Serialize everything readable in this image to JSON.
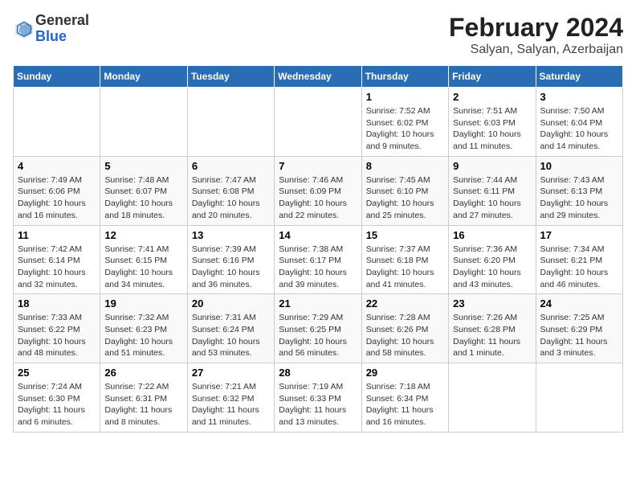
{
  "logo": {
    "general": "General",
    "blue": "Blue"
  },
  "title": "February 2024",
  "subtitle": "Salyan, Salyan, Azerbaijan",
  "days_of_week": [
    "Sunday",
    "Monday",
    "Tuesday",
    "Wednesday",
    "Thursday",
    "Friday",
    "Saturday"
  ],
  "weeks": [
    [
      {
        "day": "",
        "content": ""
      },
      {
        "day": "",
        "content": ""
      },
      {
        "day": "",
        "content": ""
      },
      {
        "day": "",
        "content": ""
      },
      {
        "day": "1",
        "content": "Sunrise: 7:52 AM\nSunset: 6:02 PM\nDaylight: 10 hours and 9 minutes."
      },
      {
        "day": "2",
        "content": "Sunrise: 7:51 AM\nSunset: 6:03 PM\nDaylight: 10 hours and 11 minutes."
      },
      {
        "day": "3",
        "content": "Sunrise: 7:50 AM\nSunset: 6:04 PM\nDaylight: 10 hours and 14 minutes."
      }
    ],
    [
      {
        "day": "4",
        "content": "Sunrise: 7:49 AM\nSunset: 6:06 PM\nDaylight: 10 hours and 16 minutes."
      },
      {
        "day": "5",
        "content": "Sunrise: 7:48 AM\nSunset: 6:07 PM\nDaylight: 10 hours and 18 minutes."
      },
      {
        "day": "6",
        "content": "Sunrise: 7:47 AM\nSunset: 6:08 PM\nDaylight: 10 hours and 20 minutes."
      },
      {
        "day": "7",
        "content": "Sunrise: 7:46 AM\nSunset: 6:09 PM\nDaylight: 10 hours and 22 minutes."
      },
      {
        "day": "8",
        "content": "Sunrise: 7:45 AM\nSunset: 6:10 PM\nDaylight: 10 hours and 25 minutes."
      },
      {
        "day": "9",
        "content": "Sunrise: 7:44 AM\nSunset: 6:11 PM\nDaylight: 10 hours and 27 minutes."
      },
      {
        "day": "10",
        "content": "Sunrise: 7:43 AM\nSunset: 6:13 PM\nDaylight: 10 hours and 29 minutes."
      }
    ],
    [
      {
        "day": "11",
        "content": "Sunrise: 7:42 AM\nSunset: 6:14 PM\nDaylight: 10 hours and 32 minutes."
      },
      {
        "day": "12",
        "content": "Sunrise: 7:41 AM\nSunset: 6:15 PM\nDaylight: 10 hours and 34 minutes."
      },
      {
        "day": "13",
        "content": "Sunrise: 7:39 AM\nSunset: 6:16 PM\nDaylight: 10 hours and 36 minutes."
      },
      {
        "day": "14",
        "content": "Sunrise: 7:38 AM\nSunset: 6:17 PM\nDaylight: 10 hours and 39 minutes."
      },
      {
        "day": "15",
        "content": "Sunrise: 7:37 AM\nSunset: 6:18 PM\nDaylight: 10 hours and 41 minutes."
      },
      {
        "day": "16",
        "content": "Sunrise: 7:36 AM\nSunset: 6:20 PM\nDaylight: 10 hours and 43 minutes."
      },
      {
        "day": "17",
        "content": "Sunrise: 7:34 AM\nSunset: 6:21 PM\nDaylight: 10 hours and 46 minutes."
      }
    ],
    [
      {
        "day": "18",
        "content": "Sunrise: 7:33 AM\nSunset: 6:22 PM\nDaylight: 10 hours and 48 minutes."
      },
      {
        "day": "19",
        "content": "Sunrise: 7:32 AM\nSunset: 6:23 PM\nDaylight: 10 hours and 51 minutes."
      },
      {
        "day": "20",
        "content": "Sunrise: 7:31 AM\nSunset: 6:24 PM\nDaylight: 10 hours and 53 minutes."
      },
      {
        "day": "21",
        "content": "Sunrise: 7:29 AM\nSunset: 6:25 PM\nDaylight: 10 hours and 56 minutes."
      },
      {
        "day": "22",
        "content": "Sunrise: 7:28 AM\nSunset: 6:26 PM\nDaylight: 10 hours and 58 minutes."
      },
      {
        "day": "23",
        "content": "Sunrise: 7:26 AM\nSunset: 6:28 PM\nDaylight: 11 hours and 1 minute."
      },
      {
        "day": "24",
        "content": "Sunrise: 7:25 AM\nSunset: 6:29 PM\nDaylight: 11 hours and 3 minutes."
      }
    ],
    [
      {
        "day": "25",
        "content": "Sunrise: 7:24 AM\nSunset: 6:30 PM\nDaylight: 11 hours and 6 minutes."
      },
      {
        "day": "26",
        "content": "Sunrise: 7:22 AM\nSunset: 6:31 PM\nDaylight: 11 hours and 8 minutes."
      },
      {
        "day": "27",
        "content": "Sunrise: 7:21 AM\nSunset: 6:32 PM\nDaylight: 11 hours and 11 minutes."
      },
      {
        "day": "28",
        "content": "Sunrise: 7:19 AM\nSunset: 6:33 PM\nDaylight: 11 hours and 13 minutes."
      },
      {
        "day": "29",
        "content": "Sunrise: 7:18 AM\nSunset: 6:34 PM\nDaylight: 11 hours and 16 minutes."
      },
      {
        "day": "",
        "content": ""
      },
      {
        "day": "",
        "content": ""
      }
    ]
  ]
}
